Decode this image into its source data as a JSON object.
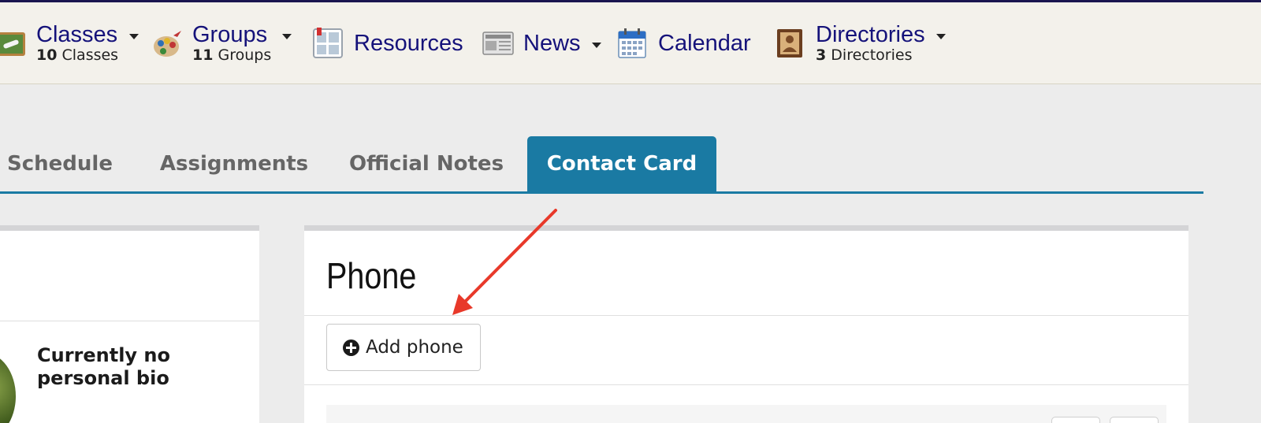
{
  "nav": {
    "classes": {
      "title": "Classes",
      "count": "10",
      "unit": "Classes",
      "icon": "chalkboard-icon"
    },
    "groups": {
      "title": "Groups",
      "count": "11",
      "unit": "Groups",
      "icon": "palette-icon"
    },
    "resources": {
      "title": "Resources",
      "icon": "resources-icon"
    },
    "news": {
      "title": "News",
      "icon": "newspaper-icon"
    },
    "calendar": {
      "title": "Calendar",
      "icon": "calendar-icon"
    },
    "directories": {
      "title": "Directories",
      "count": "3",
      "unit": "Directories",
      "icon": "address-book-icon"
    }
  },
  "tabs": [
    {
      "label": "Schedule",
      "active": false
    },
    {
      "label": "Assignments",
      "active": false
    },
    {
      "label": "Official Notes",
      "active": false
    },
    {
      "label": "Contact Card",
      "active": true
    }
  ],
  "profile": {
    "bio": "Currently no personal bio"
  },
  "phone_section": {
    "title": "Phone",
    "add_label": "Add phone"
  },
  "colors": {
    "accent": "#1a7aa3",
    "nav_link": "#15127a",
    "annotation_arrow": "#e8392a"
  }
}
